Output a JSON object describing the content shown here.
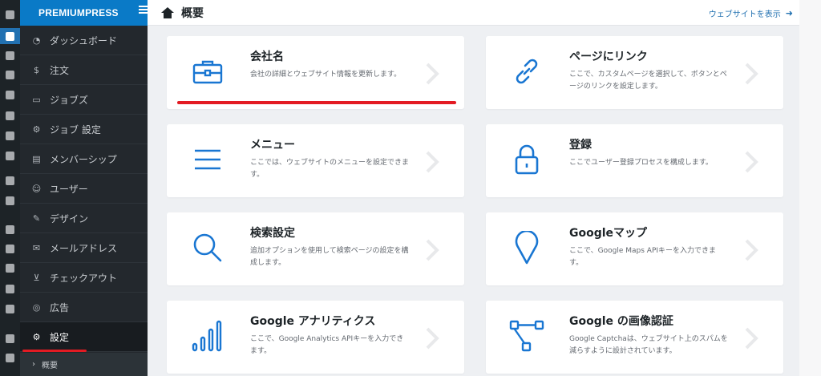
{
  "brand": "PREMIUMPRESS",
  "header": {
    "title": "概要",
    "view_site": "ウェブサイトを表示"
  },
  "menu": [
    {
      "label": "ダッシュボード",
      "icon": "gauge-icon"
    },
    {
      "label": "注文",
      "icon": "dollar-icon"
    },
    {
      "label": "ジョブズ",
      "icon": "briefcase-icon"
    },
    {
      "label": "ジョブ 設定",
      "icon": "briefcase-gear-icon"
    },
    {
      "label": "メンバーシップ",
      "icon": "membership-icon"
    },
    {
      "label": "ユーザー",
      "icon": "users-icon"
    },
    {
      "label": "デザイン",
      "icon": "brush-icon"
    },
    {
      "label": "メールアドレス",
      "icon": "envelope-icon"
    },
    {
      "label": "チェックアウト",
      "icon": "cart-icon"
    },
    {
      "label": "広告",
      "icon": "target-icon"
    },
    {
      "label": "設定",
      "icon": "gear-icon",
      "active": true
    }
  ],
  "submenu": {
    "label": "概要"
  },
  "cards": [
    {
      "title": "会社名",
      "desc": "会社の詳細とウェブサイト情報を更新します。",
      "icon": "briefcase-icon"
    },
    {
      "title": "ページにリンク",
      "desc": "ここで、カスタムページを選択して、ボタンとページのリンクを設定します。",
      "icon": "link-icon"
    },
    {
      "title": "メニュー",
      "desc": "ここでは、ウェブサイトのメニューを設定できます。",
      "icon": "menu-lines-icon"
    },
    {
      "title": "登録",
      "desc": "ここでユーザー登録プロセスを構成します。",
      "icon": "lock-icon"
    },
    {
      "title": "検索設定",
      "desc": "追加オプションを使用して検索ページの設定を構成します。",
      "icon": "search-icon"
    },
    {
      "title": "Googleマップ",
      "desc": "ここで、Google Maps APIキーを入力できます。",
      "icon": "map-pin-icon"
    },
    {
      "title": "Google アナリティクス",
      "desc": "ここで、Google Analytics APIキーを入力できます。",
      "icon": "signal-bars-icon"
    },
    {
      "title": "Google の画像認証",
      "desc": "Google Captchaは、ウェブサイト上のスパムを減らすように設計されています。",
      "icon": "flow-icon"
    }
  ],
  "colors": {
    "accent": "#0a7ac7",
    "icon_blue": "#1976d2",
    "highlight_red": "#e31b23",
    "sidebar_bg": "#23282d"
  }
}
